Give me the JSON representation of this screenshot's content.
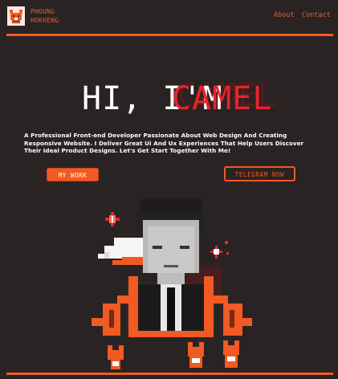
{
  "header": {
    "brand_line1": "PHOUNG",
    "brand_line2": "HOKHENG",
    "nav": [
      {
        "label": "About"
      },
      {
        "label": "Contact"
      }
    ]
  },
  "hero": {
    "greeting": "HI, I'M",
    "name": "CAMEL",
    "intro": "A Professional Front-end Developer Passionate About Web Design And Creating Responsive Website. I Deliver Great Ui And Ux Experiences That Help Users Discover Their Ideal Product Designs. Let's Get Start Together With Me!",
    "primary_button": "MY WORK",
    "secondary_button": "TELEGRAM NOW"
  },
  "colors": {
    "background": "#2a2323",
    "accent": "#f15a22",
    "name_color": "#e8232b",
    "text": "#ffffff"
  }
}
